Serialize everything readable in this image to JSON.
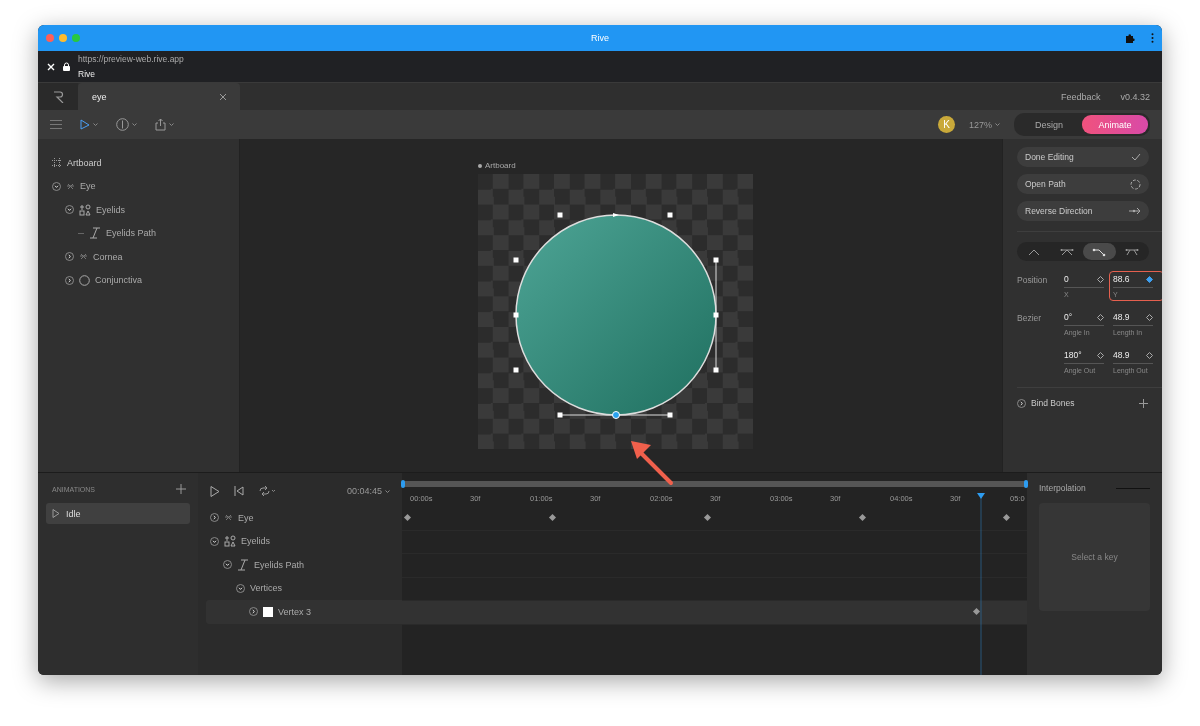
{
  "browser": {
    "title": "Rive",
    "url": "https://preview-web.rive.app",
    "page_title": "Rive"
  },
  "tabs": [
    {
      "label": "eye",
      "selected": true
    }
  ],
  "header": {
    "feedback": "Feedback",
    "version": "v0.4.32"
  },
  "toolbar": {
    "avatar": "K",
    "zoom": "127%",
    "modes": [
      {
        "label": "Design",
        "selected": false
      },
      {
        "label": "Animate",
        "selected": true
      }
    ]
  },
  "hierarchy": {
    "root": "Artboard",
    "items": [
      {
        "label": "Eye",
        "kind": "group",
        "expanded": true,
        "children": [
          {
            "label": "Eyelids",
            "kind": "shape",
            "expanded": true,
            "children": [
              {
                "label": "Eyelids Path",
                "kind": "path"
              }
            ]
          },
          {
            "label": "Cornea",
            "kind": "group",
            "expanded": false
          },
          {
            "label": "Conjunctiva",
            "kind": "ellipse",
            "expanded": false
          }
        ]
      }
    ]
  },
  "canvas": {
    "artboard_label": "Artboard"
  },
  "inspector": {
    "actions": [
      {
        "label": "Done Editing"
      },
      {
        "label": "Open Path"
      },
      {
        "label": "Reverse Direction"
      }
    ],
    "vertex_modes": [
      {
        "selected": false
      },
      {
        "selected": false
      },
      {
        "selected": true
      },
      {
        "selected": false
      }
    ],
    "rows": [
      {
        "label": "Position",
        "fields": [
          {
            "value": "0",
            "caption": "X",
            "keyed": false,
            "highlighted": false
          },
          {
            "value": "88.6",
            "caption": "Y",
            "keyed": true,
            "highlighted": true
          }
        ]
      },
      {
        "label": "Bezier",
        "fields": [
          {
            "value": "0°",
            "caption": "Angle In",
            "keyed": false,
            "highlighted": false
          },
          {
            "value": "48.9",
            "caption": "Length In",
            "keyed": false,
            "highlighted": false
          }
        ]
      },
      {
        "fields": [
          {
            "value": "180°",
            "caption": "Angle Out",
            "keyed": false,
            "highlighted": false
          },
          {
            "value": "48.9",
            "caption": "Length Out",
            "keyed": false,
            "highlighted": false
          }
        ]
      }
    ],
    "bind_bones": {
      "label": "Bind Bones",
      "expanded": false
    }
  },
  "animations": {
    "heading": "ANIMATIONS",
    "items": [
      {
        "label": "Idle",
        "selected": true
      }
    ]
  },
  "timeline": {
    "time": "00:04:45",
    "tree": [
      {
        "label": "Eye",
        "kind": "group",
        "expanded": false,
        "selected": false
      },
      {
        "label": "Eyelids",
        "kind": "shape",
        "expanded": true,
        "selected": false,
        "children": [
          {
            "label": "Eyelids Path",
            "kind": "path",
            "expanded": true,
            "selected": false,
            "children": [
              {
                "label": "Vertices",
                "expanded": true,
                "selected": false,
                "children": [
                  {
                    "label": "Vertex 3",
                    "kind": "vertex",
                    "expanded": false,
                    "selected": true
                  }
                ]
              }
            ]
          }
        ]
      }
    ],
    "ruler": [
      "00:00s",
      "30f",
      "01:00s",
      "30f",
      "02:00s",
      "30f",
      "03:00s",
      "30f",
      "04:00s",
      "30f",
      "05:0"
    ]
  },
  "interpolation": {
    "title": "Interpolation",
    "empty": "Select a key"
  }
}
